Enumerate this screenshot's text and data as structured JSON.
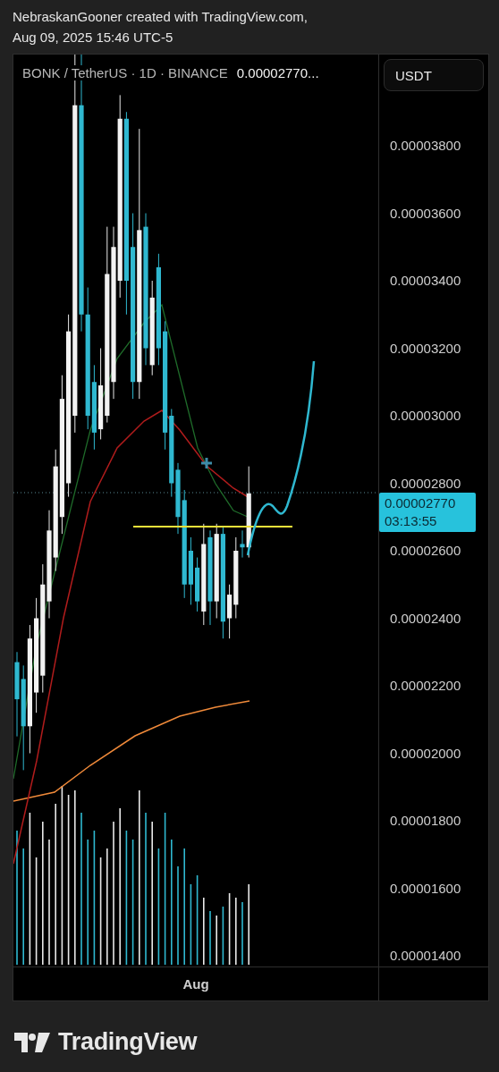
{
  "header": {
    "lines": [
      "NebraskanGooner created with TradingView.com,",
      "Aug 09, 2025 15:46 UTC-5"
    ]
  },
  "chart": {
    "symbol": "BONK / TetherUS · 1D · BINANCE",
    "last_price": "0.00002770...",
    "currency_button": "USDT",
    "price_ticks": [
      "0.00003800",
      "0.00003600",
      "0.00003400",
      "0.00003200",
      "0.00003000",
      "0.00002800",
      "0.00002600",
      "0.00002400",
      "0.00002200",
      "0.00002000",
      "0.00001800",
      "0.00001600",
      "0.00001400"
    ],
    "price_badge": {
      "price": "0.00002770",
      "countdown": "03:13:55"
    },
    "time_ticks": [
      "Aug"
    ]
  },
  "brand": {
    "name": "TradingView"
  }
}
